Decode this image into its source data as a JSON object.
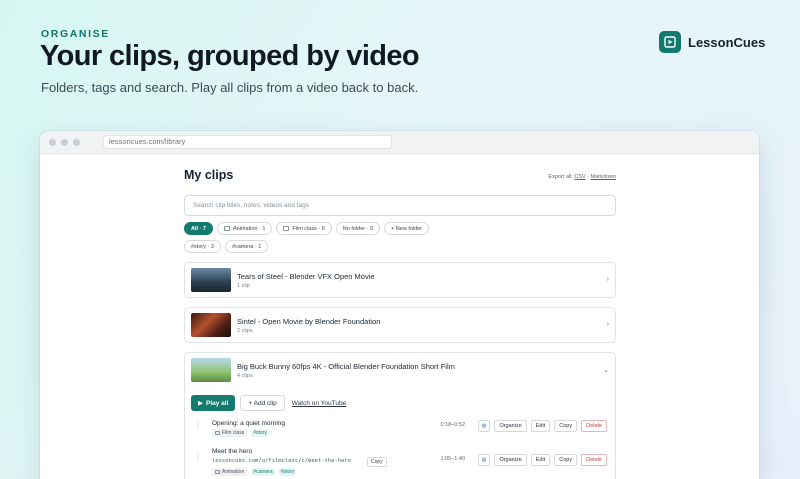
{
  "hero": {
    "eyebrow": "ORGANISE",
    "headline": "Your clips, grouped by video",
    "subhead": "Folders, tags and search. Play all clips from a video back to back."
  },
  "brand": {
    "name": "LessonCues",
    "color": "#127a6d"
  },
  "browser": {
    "url": "lessoncues.com/library"
  },
  "page": {
    "title": "My clips",
    "export_label": "Export all:",
    "export_csv": "CSV",
    "export_sep": "·",
    "export_markdown": "Markdown",
    "search_placeholder": "Search clip titles, notes, videos and tags"
  },
  "filters": {
    "all": "All · 7",
    "animation": "Animation · 1",
    "film_class": "Film class · 6",
    "no_folder": "No folder · 0",
    "new_folder": "+ New folder",
    "tag_story": "#story · 3",
    "tag_camera": "#camera · 1"
  },
  "videos": [
    {
      "title": "Tears of Steel - Blender VFX Open Movie",
      "count": "1 clip",
      "chevron": "›"
    },
    {
      "title": "Sintel - Open Movie by Blender Foundation",
      "count": "2 clips",
      "chevron": "›"
    },
    {
      "title": "Big Buck Bunny 60fps 4K - Official Blender Foundation Short Film",
      "count": "4 clips",
      "chevron": "⌄"
    }
  ],
  "expanded": {
    "play_all": "Play all",
    "add_clip": "+ Add clip",
    "watch": "Watch on YouTube"
  },
  "clips": [
    {
      "title": "Opening: a quiet morning",
      "folder": "Film class",
      "tags": [
        "#story"
      ],
      "time": "0:18–0:52"
    },
    {
      "title": "Meet the hero",
      "url": "lessoncues.com/u/filmclass/c/meet-the-hero",
      "folder": "Animation",
      "tags": [
        "#camera",
        "#story"
      ],
      "time": "1:05–1:40"
    }
  ],
  "clip_buttons": {
    "organize": "Organize",
    "edit": "Edit",
    "copy": "Copy",
    "delete": "Delete"
  },
  "colors": {
    "accent": "#147a6d",
    "danger": "#c43b3b"
  }
}
